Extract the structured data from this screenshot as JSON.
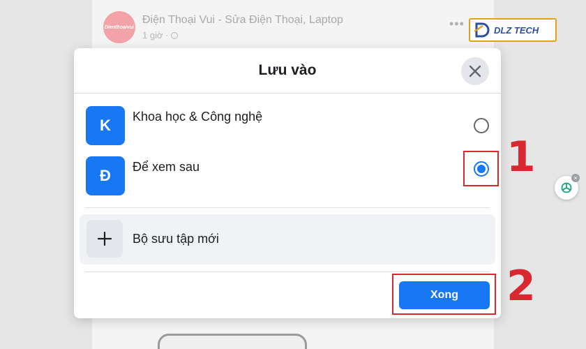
{
  "feed": {
    "post_avatar_text": "Dienthoaivui",
    "post_author": "Điện Thoại Vui - Sửa Điện Thoại, Laptop",
    "post_time": "1 giờ ·",
    "more_icon": "ellipsis-icon",
    "watermark_logo_text": "DLZ TECH"
  },
  "modal": {
    "title": "Lưu vào",
    "close_icon": "close-icon",
    "collections": [
      {
        "initial": "K",
        "label": "Khoa học & Công nghệ",
        "selected": false
      },
      {
        "initial": "Đ",
        "label": "Để xem sau",
        "selected": true
      }
    ],
    "new_collection": {
      "icon": "plus-icon",
      "label": "Bộ sưu tập mới"
    },
    "done_label": "Xong"
  },
  "annotations": {
    "step_1": "1",
    "step_2": "2",
    "color": "#d9282f"
  },
  "colors": {
    "accent": "#1877f2",
    "text": "#1c1e21",
    "secondary_bg": "#f0f2f5"
  }
}
